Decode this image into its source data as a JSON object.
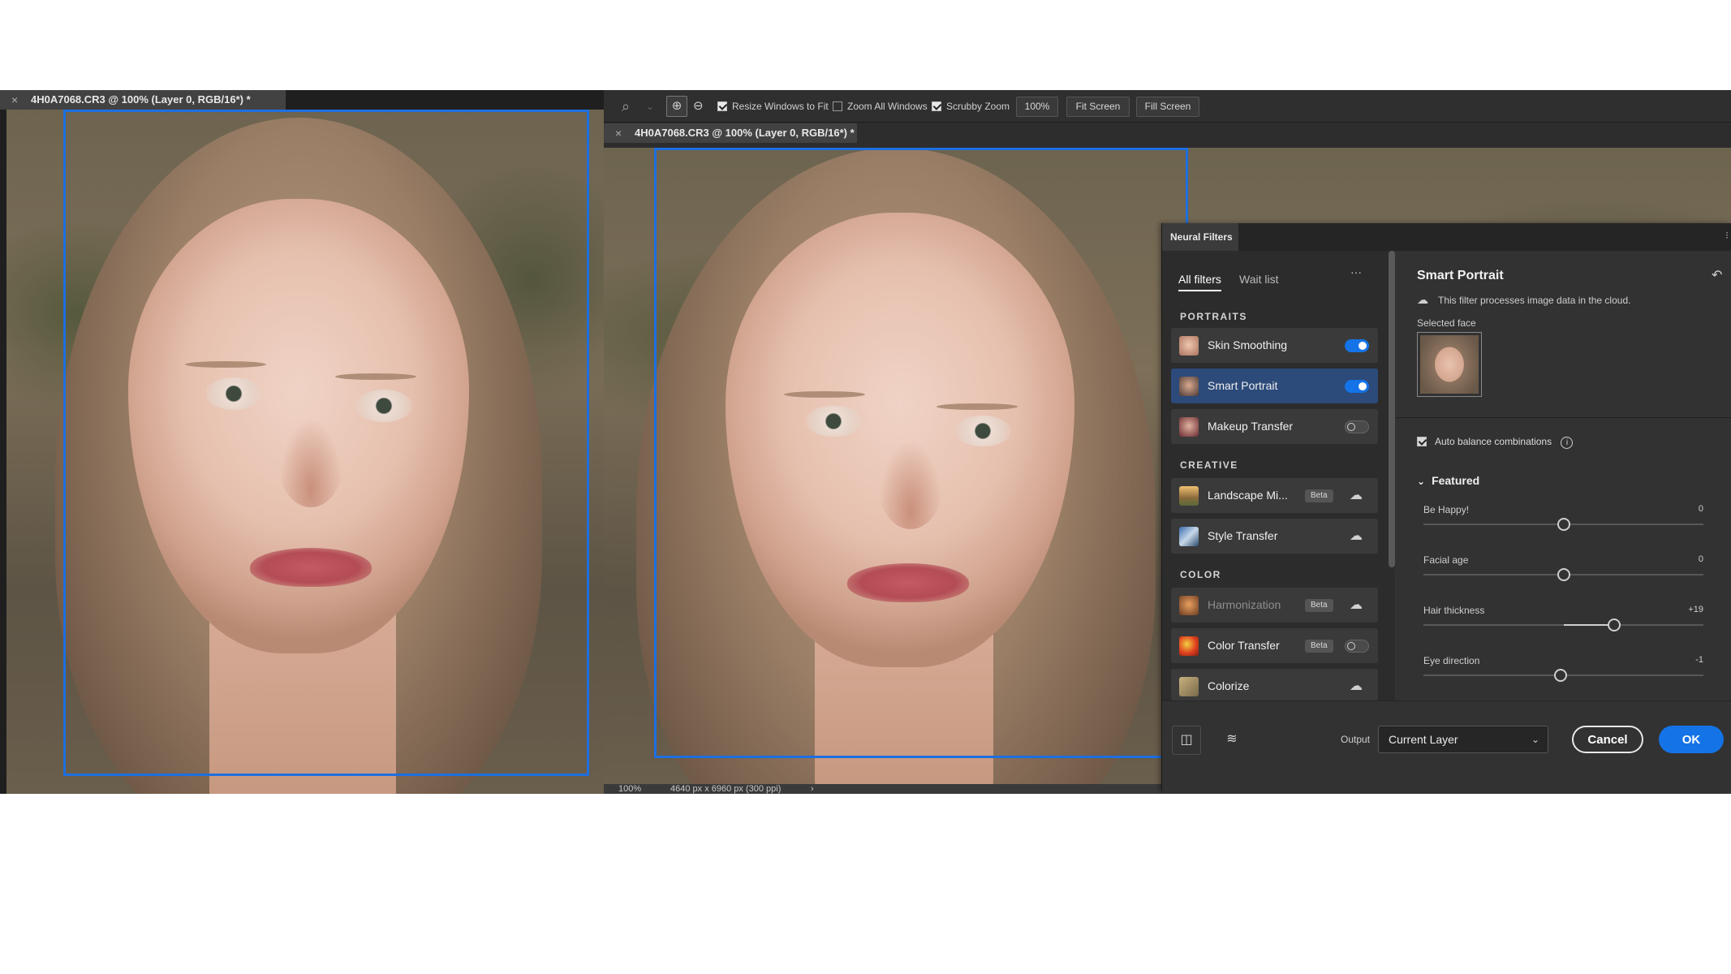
{
  "left_document": {
    "tab_title": "4H0A7068.CR3 @ 100% (Layer 0, RGB/16*) *"
  },
  "right_document": {
    "tab_title": "4H0A7068.CR3 @ 100% (Layer 0, RGB/16*) *"
  },
  "toolbar": {
    "resize_windows": "Resize Windows to Fit",
    "zoom_all": "Zoom All Windows",
    "scrubby_zoom": "Scrubby Zoom",
    "zoom_value": "100%",
    "fit_screen": "Fit Screen",
    "fill_screen": "Fill Screen",
    "resize_checked": true,
    "zoom_all_checked": false,
    "scrubby_checked": true
  },
  "status_bar": {
    "zoom": "100%",
    "doc_size": "4640 px x 6960 px (300 ppi)"
  },
  "neural_filters": {
    "panel_title": "Neural Filters",
    "tabs": [
      "All filters",
      "Wait list"
    ],
    "more": "···",
    "sections": {
      "portraits": "PORTRAITS",
      "creative": "CREATIVE",
      "color": "COLOR"
    },
    "filters": {
      "skin_smoothing": "Skin Smoothing",
      "smart_portrait": "Smart Portrait",
      "makeup_transfer": "Makeup Transfer",
      "landscape_mixer": "Landscape Mi...",
      "style_transfer": "Style Transfer",
      "harmonization": "Harmonization",
      "color_transfer": "Color Transfer",
      "colorize": "Colorize"
    },
    "beta_label": "Beta",
    "detail": {
      "title": "Smart Portrait",
      "cloud_note": "This filter processes image data in the cloud.",
      "selected_face": "Selected face",
      "auto_balance": "Auto balance combinations",
      "featured": "Featured",
      "sliders": [
        {
          "label": "Be Happy!",
          "value": "0",
          "position": 0.5
        },
        {
          "label": "Facial age",
          "value": "0",
          "position": 0.5
        },
        {
          "label": "Hair thickness",
          "value": "+19",
          "position": 0.68
        },
        {
          "label": "Eye direction",
          "value": "-1",
          "position": 0.49
        }
      ]
    },
    "footer": {
      "output_label": "Output",
      "output_value": "Current Layer",
      "cancel": "Cancel",
      "ok": "OK"
    }
  }
}
